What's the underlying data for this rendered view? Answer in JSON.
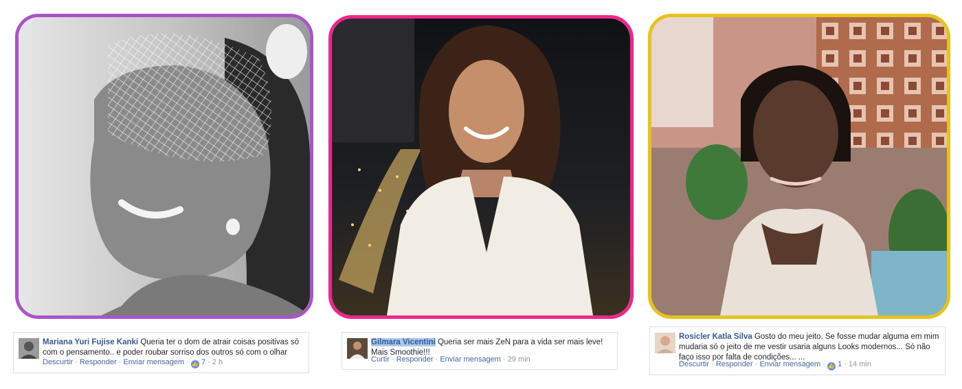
{
  "colors": {
    "frame1": "#a855c8",
    "frame2": "#f0268c",
    "frame3": "#e8c21c",
    "link": "#4267b2",
    "name": "#365899",
    "meta": "#90949c"
  },
  "posts": [
    {
      "author": "Mariana Yuri Fujise Kanki",
      "text": "Queria ter o dom de atrair coisas positivas só com o pensamento.. e poder roubar sorriso dos outros só com o olhar",
      "action1": "Descurtir",
      "action2": "Responder",
      "action3": "Enviar mensagem",
      "like_icon": "thumbs-up-icon",
      "likes": "7",
      "time": "2 h"
    },
    {
      "author": "Gilmara Vicentini",
      "text": "Queria ser mais ZeN para a vida ser mais leve! Mais Smoothie!!!",
      "action1": "Curtir",
      "action2": "Responder",
      "action3": "Enviar mensagem",
      "time": "29 min"
    },
    {
      "author": "Rosicler Katla Silva",
      "text": "Gosto do meu jeito. Se fosse mudar alguma em mim mudaria só o jeito de me vestir usaria alguns Looks modernos... Só não faço isso por falta de condições... ...",
      "action1": "Descurtir",
      "action2": "Responder",
      "action3": "Enviar mensagem",
      "like_icon": "thumbs-up-icon",
      "likes": "1",
      "time": "14 min"
    }
  ]
}
